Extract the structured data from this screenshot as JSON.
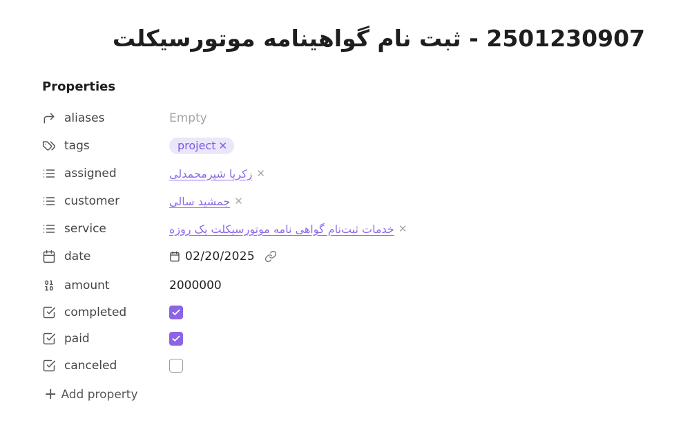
{
  "page": {
    "title": "2501230907 - ثبت نام گواهینامه موتورسیکلت"
  },
  "properties": {
    "heading": "Properties",
    "add_label": "Add property",
    "aliases": {
      "label": "aliases",
      "icon": "arrow-right-icon",
      "value": "Empty"
    },
    "tags": {
      "label": "tags",
      "icon": "tags-icon",
      "value": "project",
      "remove": "✕"
    },
    "assigned": {
      "label": "assigned",
      "icon": "list-icon",
      "value": "زکریا شیرمحمدلی",
      "remove": "✕"
    },
    "customer": {
      "label": "customer",
      "icon": "list-icon",
      "value": "جمشید سالی",
      "remove": "✕"
    },
    "service": {
      "label": "service",
      "icon": "list-icon",
      "value": "خدمات ثبت‌نام گواهی نامه موتورسیکلت یک روزه",
      "remove": "✕"
    },
    "date": {
      "label": "date",
      "icon": "calendar-icon",
      "value": "02/20/2025"
    },
    "amount": {
      "label": "amount",
      "icon": "binary-icon",
      "value": "2000000"
    },
    "completed": {
      "label": "completed",
      "icon": "checkbox-icon",
      "checked": true
    },
    "paid": {
      "label": "paid",
      "icon": "checkbox-icon",
      "checked": true
    },
    "canceled": {
      "label": "canceled",
      "icon": "checkbox-icon",
      "checked": false
    }
  },
  "colors": {
    "accent": "#8b65e4",
    "tag_bg": "#ece6fb",
    "link": "#8d6be6",
    "muted": "#a3a3a3"
  }
}
